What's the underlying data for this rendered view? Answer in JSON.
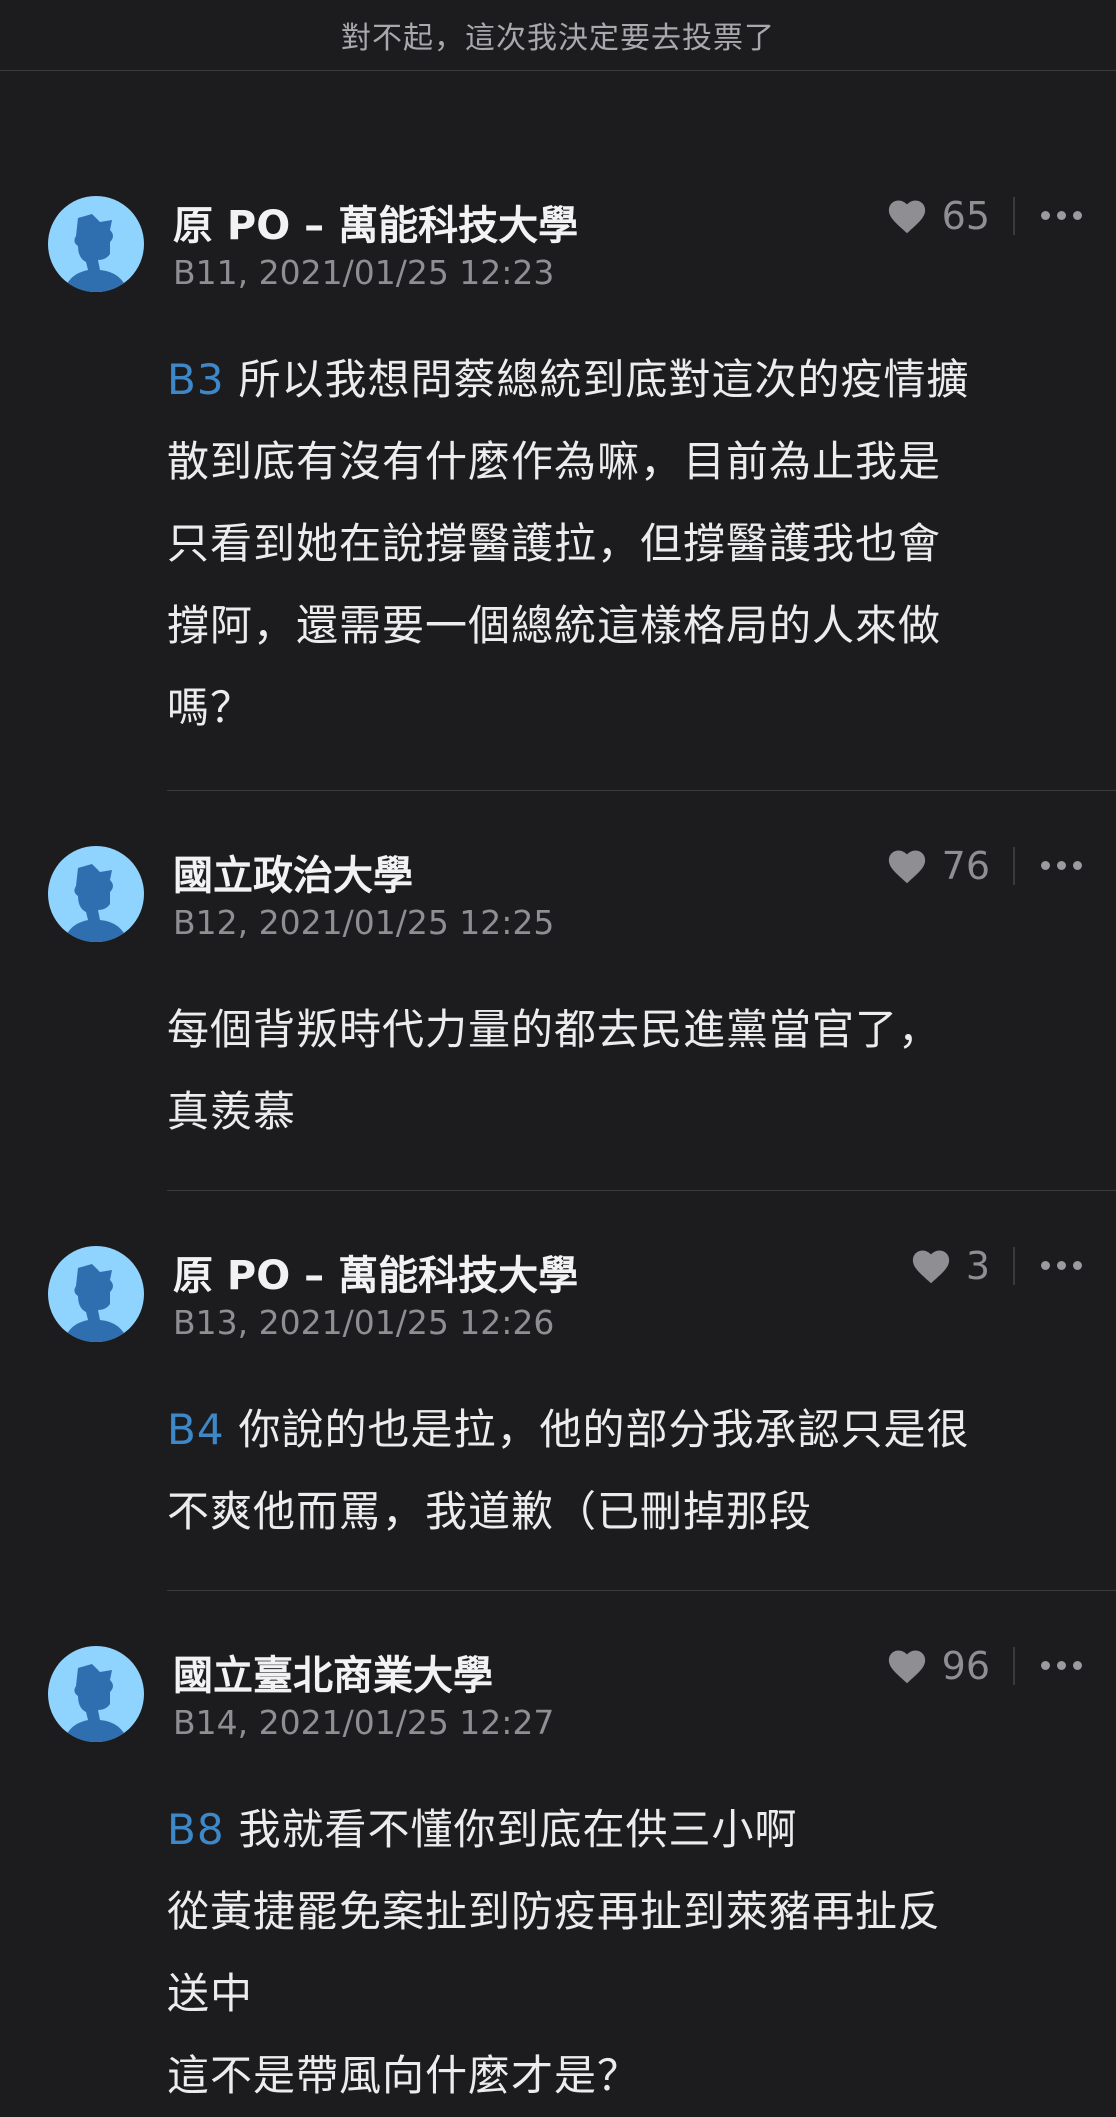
{
  "header": {
    "title": "對不起，這次我決定要去投票了"
  },
  "comments": [
    {
      "author": "原 PO – 萬能科技大學",
      "floor_time": "B11, 2021/01/25 12:23",
      "likes": "65",
      "reply_ref": "B3",
      "lines": [
        "所以我想問蔡總統到底對這次的疫情擴",
        "散到底有沒有什麼作為嘛，目前為止我是",
        "只看到她在說撐醫護拉，但撐醫護我也會",
        "撐阿，還需要一個總統這樣格局的人來做",
        "嗎？"
      ]
    },
    {
      "author": "國立政治大學",
      "floor_time": "B12, 2021/01/25 12:25",
      "likes": "76",
      "reply_ref": "",
      "lines": [
        "每個背叛時代力量的都去民進黨當官了，",
        "真羨慕"
      ]
    },
    {
      "author": "原 PO – 萬能科技大學",
      "floor_time": "B13, 2021/01/25 12:26",
      "likes": "3",
      "reply_ref": "B4",
      "lines": [
        "你說的也是拉，他的部分我承認只是很",
        "不爽他而罵，我道歉（已刪掉那段"
      ]
    },
    {
      "author": "國立臺北商業大學",
      "floor_time": "B14, 2021/01/25 12:27",
      "likes": "96",
      "reply_ref": "B8",
      "lines": [
        "我就看不懂你到底在供三小啊",
        "從黃捷罷免案扯到防疫再扯到萊豬再扯反",
        "送中",
        "這不是帶風向什麼才是？"
      ]
    }
  ],
  "icons": {
    "avatar": "user-silhouette-icon",
    "like": "heart-icon",
    "more": "more-dots-icon"
  },
  "colors": {
    "background": "#1c1c1e",
    "reply_ref": "#3f88c8",
    "avatar_bg": "#8fd3ff"
  }
}
